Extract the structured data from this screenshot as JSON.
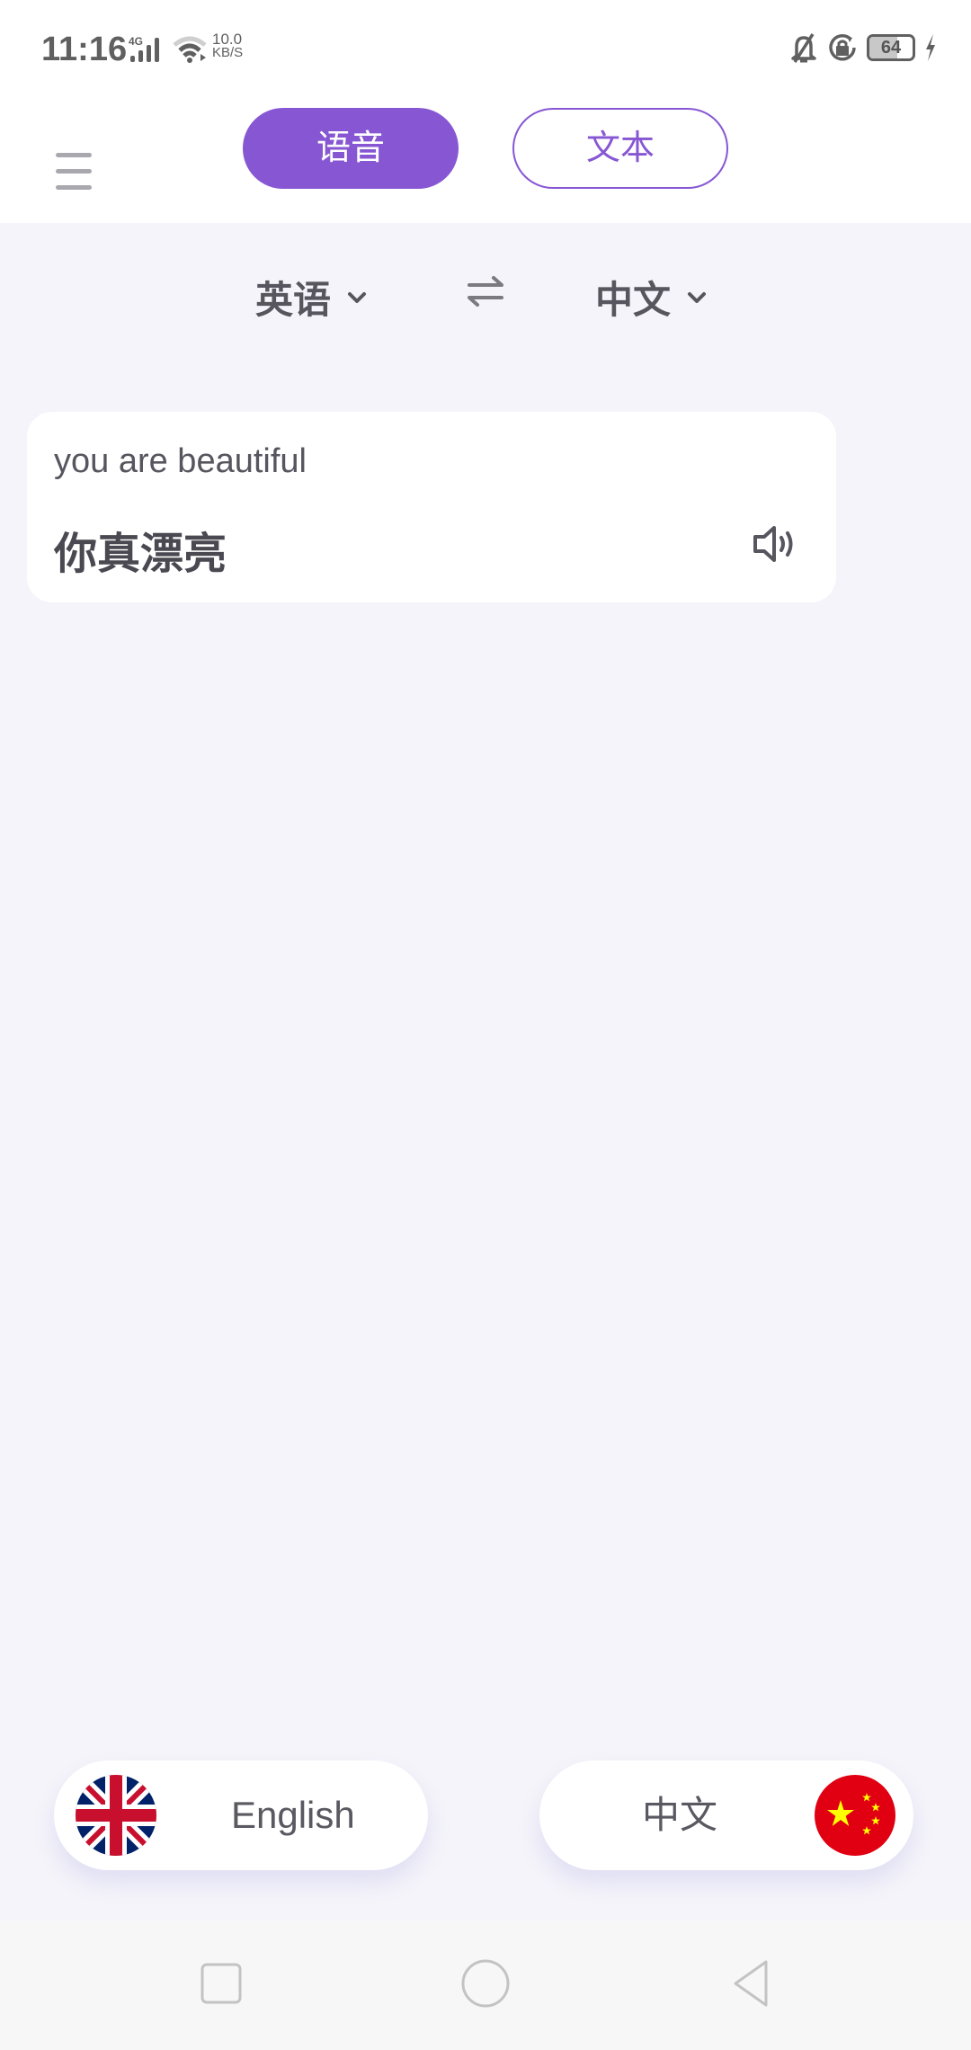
{
  "status_bar": {
    "time": "11:16",
    "network_type": "4G",
    "net_speed_value": "10.0",
    "net_speed_unit": "KB/S",
    "battery_level": "64",
    "battery_fraction": 0.64,
    "icons": [
      "signal-icon",
      "wifi-icon",
      "bell-muted-icon",
      "rotation-lock-icon",
      "battery-icon",
      "charging-icon"
    ]
  },
  "header": {
    "menu_icon": "menu-icon",
    "tabs": [
      {
        "label": "语音",
        "active": true
      },
      {
        "label": "文本",
        "active": false
      }
    ],
    "accent_color": "#8757d3"
  },
  "language_bar": {
    "source_language": "英语",
    "target_language": "中文",
    "swap_icon": "swap-arrows-icon"
  },
  "result": {
    "source_text": "you are beautiful",
    "translated_text": "你真漂亮",
    "speak_icon": "speaker-icon"
  },
  "bottom_buttons": {
    "left": {
      "label": "English",
      "flag": "uk-flag-icon"
    },
    "right": {
      "label": "中文",
      "flag": "china-flag-icon"
    }
  },
  "nav_bar": {
    "buttons": [
      "recent-apps-icon",
      "home-icon",
      "back-icon"
    ]
  }
}
